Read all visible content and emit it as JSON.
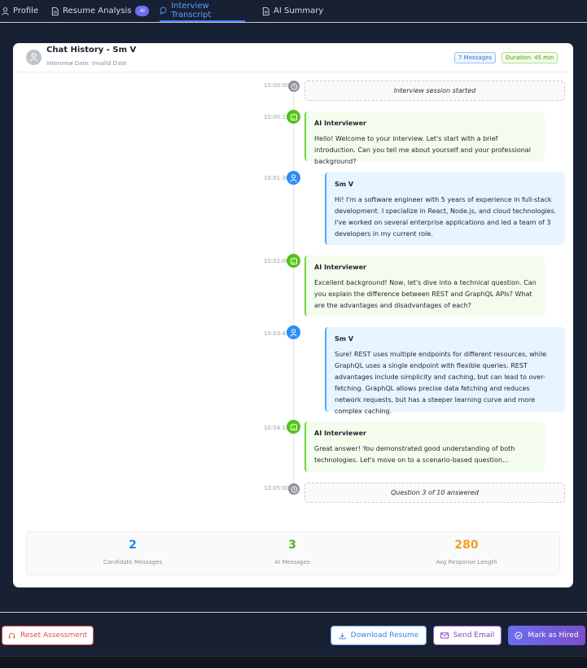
{
  "tabs": [
    {
      "label": "Profile",
      "icon": "user-icon"
    },
    {
      "label": "Resume Analysis",
      "icon": "document-icon",
      "badge": "AI"
    },
    {
      "label": "Interview Transcript",
      "icon": "chat-icon",
      "active": true
    },
    {
      "label": "AI Summary",
      "icon": "document-icon"
    }
  ],
  "header": {
    "title": "Chat History - Sm V",
    "date": "Interview Date: Invalid Date",
    "messages_tag": "7 Messages",
    "duration_tag": "Duration: 45 min"
  },
  "timeline": [
    {
      "time": "10:00:00",
      "type": "system",
      "text": "Interview session started"
    },
    {
      "time": "10:00:15",
      "type": "ai",
      "sender": "AI Interviewer",
      "text": "Hello! Welcome to your interview. Let's start with a brief introduction. Can you tell me about yourself and your professional background?"
    },
    {
      "time": "10:01:30",
      "type": "user",
      "sender": "Sm V",
      "text": "Hi! I'm a software engineer with 5 years of experience in full-stack development. I specialize in React, Node.js, and cloud technologies. I've worked on several enterprise applications and led a team of 3 developers in my current role."
    },
    {
      "time": "10:02:00",
      "type": "ai",
      "sender": "AI Interviewer",
      "text": "Excellent background! Now, let's dive into a technical question. Can you explain the difference between REST and GraphQL APIs? What are the advantages and disadvantages of each?"
    },
    {
      "time": "10:03:45",
      "type": "user",
      "sender": "Sm V",
      "text": "Sure! REST uses multiple endpoints for different resources, while GraphQL uses a single endpoint with flexible queries. REST advantages include simplicity and caching, but can lead to over-fetching. GraphQL allows precise data fetching and reduces network requests, but has a steeper learning curve and more complex caching."
    },
    {
      "time": "10:04:15",
      "type": "ai",
      "sender": "AI Interviewer",
      "text": "Great answer! You demonstrated good understanding of both technologies. Let's move on to a scenario-based question..."
    },
    {
      "time": "10:05:00",
      "type": "system",
      "text": "Question 3 of 10 answered"
    }
  ],
  "stats": [
    {
      "value": "2",
      "label": "Candidate Messages",
      "color": "#1f86f0"
    },
    {
      "value": "3",
      "label": "AI Messages",
      "color": "#52b41f"
    },
    {
      "value": "280",
      "label": "Avg Response Length",
      "color": "#f0a020"
    }
  ],
  "actions": {
    "reset": "Reset Assessment",
    "download": "Download Resume",
    "email": "Send Email",
    "hire": "Mark as Hired"
  }
}
